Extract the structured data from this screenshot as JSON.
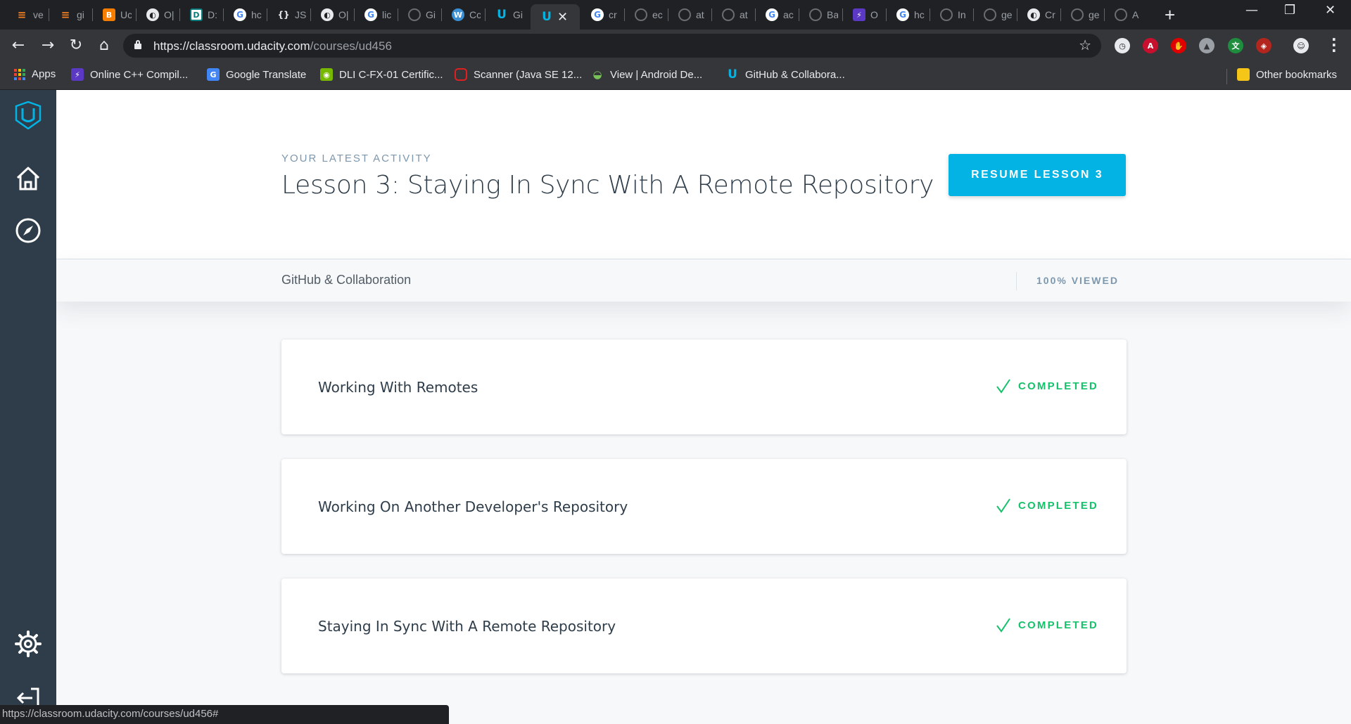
{
  "browser": {
    "tabs": [
      {
        "icon": "stackoverflow-icon",
        "label": "ve"
      },
      {
        "icon": "stackoverflow-icon",
        "label": "gi"
      },
      {
        "icon": "blogger-icon",
        "label": "Uc"
      },
      {
        "icon": "globe-icon",
        "label": "O|"
      },
      {
        "icon": "devdocs-icon",
        "label": "D:"
      },
      {
        "icon": "google-icon",
        "label": "hc"
      },
      {
        "icon": "json-icon",
        "label": "JS"
      },
      {
        "icon": "globe-icon",
        "label": "O|"
      },
      {
        "icon": "google-icon",
        "label": "lic"
      },
      {
        "icon": "github-icon",
        "label": "Gi"
      },
      {
        "icon": "wordpress-icon",
        "label": "Cc"
      },
      {
        "icon": "udacity-icon",
        "label": "Gi"
      },
      {
        "icon": "udacity-icon",
        "label": "",
        "active": true
      },
      {
        "icon": "google-icon",
        "label": "cr"
      },
      {
        "icon": "github-icon",
        "label": "ec"
      },
      {
        "icon": "github-icon",
        "label": "at"
      },
      {
        "icon": "github-icon",
        "label": "at"
      },
      {
        "icon": "google-icon",
        "label": "ac"
      },
      {
        "icon": "github-icon",
        "label": "Ba"
      },
      {
        "icon": "onlinegdb-icon",
        "label": "O"
      },
      {
        "icon": "google-icon",
        "label": "hc"
      },
      {
        "icon": "github-icon",
        "label": "In"
      },
      {
        "icon": "github-icon",
        "label": "ge"
      },
      {
        "icon": "globe-icon",
        "label": "Cr"
      },
      {
        "icon": "github-icon",
        "label": "ge"
      },
      {
        "icon": "github-icon",
        "label": "A"
      }
    ],
    "url_host": "https://classroom.udacity.com",
    "url_path": "/courses/ud456",
    "bookmarks": [
      {
        "icon": "apps-grid-icon",
        "label": "Apps"
      },
      {
        "icon": "onlinegdb-icon",
        "label": "Online C++ Compil..."
      },
      {
        "icon": "google-translate-icon",
        "label": "Google Translate"
      },
      {
        "icon": "nvidia-icon",
        "label": "DLI C-FX-01 Certific..."
      },
      {
        "icon": "oracle-icon",
        "label": "Scanner (Java SE 12..."
      },
      {
        "icon": "android-icon",
        "label": "View  |  Android De..."
      },
      {
        "icon": "udacity-icon",
        "label": "GitHub & Collabora..."
      }
    ],
    "other_bookmarks": "Other bookmarks",
    "status_url": "https://classroom.udacity.com/courses/ud456#"
  },
  "hero": {
    "eyebrow": "YOUR LATEST ACTIVITY",
    "title": "Lesson 3: Staying In Sync With A Remote Repository",
    "resume_label": "RESUME LESSON 3"
  },
  "course": {
    "name": "GitHub & Collaboration",
    "progress": "100% VIEWED"
  },
  "concepts": [
    {
      "title": "Working With Remotes",
      "status": "COMPLETED"
    },
    {
      "title": "Working On Another Developer's Repository",
      "status": "COMPLETED"
    },
    {
      "title": "Staying In Sync With A Remote Repository",
      "status": "COMPLETED"
    }
  ],
  "colors": {
    "accent": "#02b3e4",
    "completed": "#15c26b",
    "sidebar": "#2e3d49",
    "text": "#2e3d49"
  }
}
